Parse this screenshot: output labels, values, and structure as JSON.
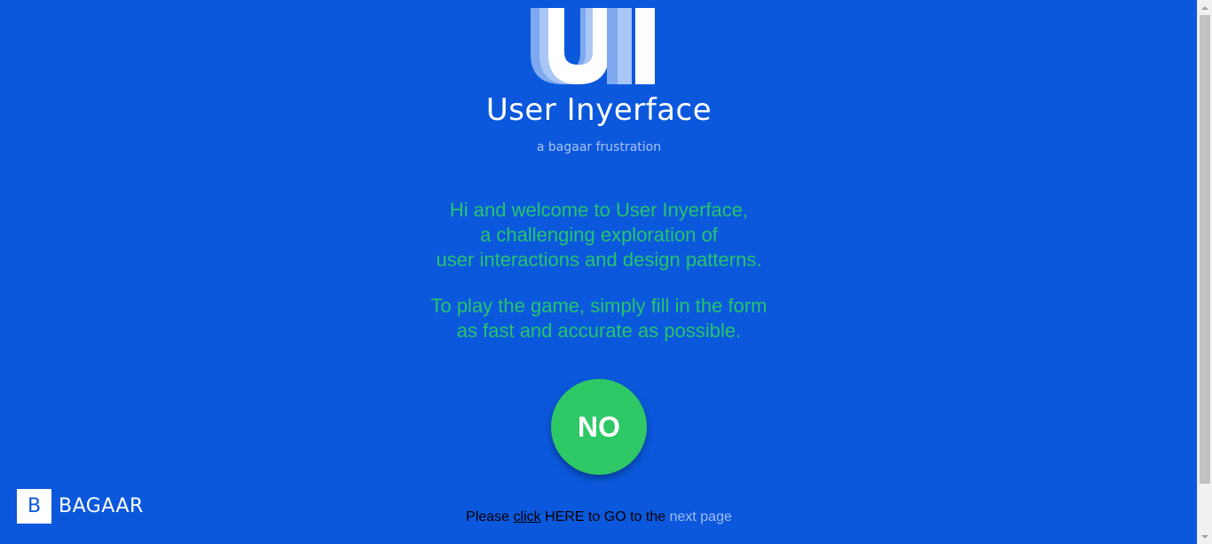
{
  "header": {
    "logo_text": "UI",
    "title": "User Inyerface",
    "tagline": "a bagaar frustration"
  },
  "intro": {
    "welcome_lines": [
      "Hi and welcome to User Inyerface,",
      "a challenging exploration of",
      "user interactions and design patterns."
    ],
    "instruction_lines": [
      "To play the game, simply fill in the form",
      "as fast and accurate as possible."
    ]
  },
  "action": {
    "no_label": "NO"
  },
  "footer": {
    "prefix": "Please ",
    "click_link": "click",
    "middle": " HERE to GO to the ",
    "next_link": "next page"
  },
  "brand": {
    "letter": "B",
    "name": "BAGAAR"
  },
  "colors": {
    "background": "#0b58dd",
    "accent_green": "#2ec866",
    "text_green": "#27c46b",
    "link_light": "#9fbcf0"
  }
}
